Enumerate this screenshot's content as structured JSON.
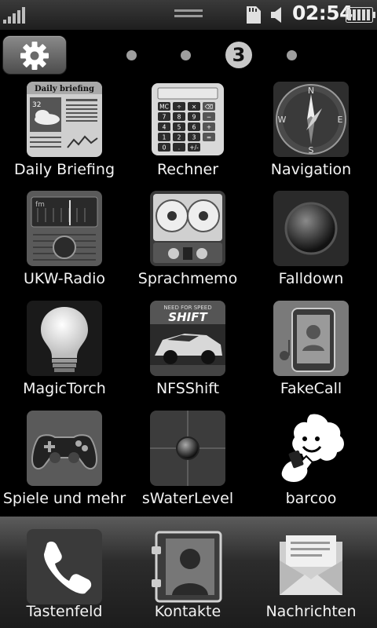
{
  "status_bar": {
    "time": "02:54"
  },
  "page_indicator": {
    "current": "3"
  },
  "apps": [
    {
      "label": "Daily Briefing",
      "icon": "daily-briefing-icon",
      "tile_title": "Daily briefing",
      "tile_temp": "32"
    },
    {
      "label": "Rechner",
      "icon": "calculator-icon",
      "keys": [
        "MC",
        "÷",
        "×",
        "⌫",
        "7",
        "8",
        "9",
        "−",
        "4",
        "5",
        "6",
        "+",
        "1",
        "2",
        "3",
        "=",
        "0",
        ".",
        "+/-"
      ]
    },
    {
      "label": "Navigation",
      "icon": "compass-icon",
      "directions": [
        "N",
        "E",
        "S",
        "W"
      ]
    },
    {
      "label": "UKW-Radio",
      "icon": "radio-icon",
      "band": "fm"
    },
    {
      "label": "Sprachmemo",
      "icon": "tape-recorder-icon"
    },
    {
      "label": "Falldown",
      "icon": "falldown-icon"
    },
    {
      "label": "MagicTorch",
      "icon": "lightbulb-icon"
    },
    {
      "label": "NFSShift",
      "icon": "race-car-icon",
      "tile_text": "SHIFT",
      "tile_subtext": "NEED FOR SPEED"
    },
    {
      "label": "FakeCall",
      "icon": "fake-call-icon"
    },
    {
      "label": "Spiele und mehr",
      "icon": "gamepad-icon"
    },
    {
      "label": "sWaterLevel",
      "icon": "water-level-icon"
    },
    {
      "label": "barcoo",
      "icon": "barcoo-icon"
    }
  ],
  "dock": [
    {
      "label": "Tastenfeld",
      "icon": "phone-icon"
    },
    {
      "label": "Kontakte",
      "icon": "contacts-icon"
    },
    {
      "label": "Nachrichten",
      "icon": "envelope-icon"
    }
  ],
  "colors": {
    "background": "#000000",
    "tile_dark": "#202020",
    "label": "#f4f4f4"
  }
}
